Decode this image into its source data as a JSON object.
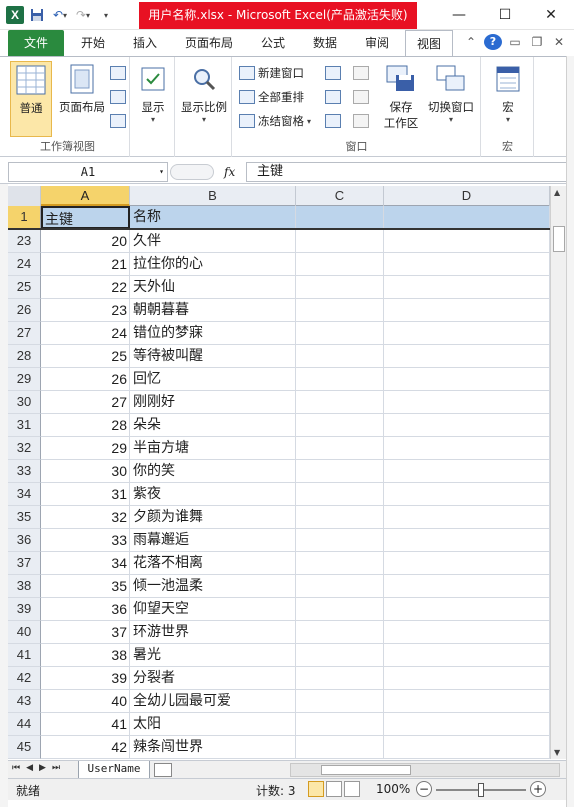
{
  "window": {
    "title": "用户名称.xlsx - Microsoft Excel(产品激活失败)",
    "app_icon": "excel-logo",
    "minimize": "—",
    "maximize": "☐",
    "close": "✕"
  },
  "ribbon_tabs": [
    "文件",
    "开始",
    "插入",
    "页面布局",
    "公式",
    "数据",
    "审阅",
    "视图"
  ],
  "active_tab": "视图",
  "ribbon": {
    "workbook_views": {
      "normal": "普通",
      "page_layout": "页面布局",
      "group_label": "工作簿视图"
    },
    "show": {
      "label": "显示"
    },
    "zoom": {
      "label": "显示比例"
    },
    "window": {
      "new_window": "新建窗口",
      "arrange_all": "全部重排",
      "freeze_panes": "冻结窗格",
      "save_workspace_line1": "保存",
      "save_workspace_line2": "工作区",
      "switch_windows": "切换窗口",
      "group_label": "窗口"
    },
    "macros": {
      "label": "宏",
      "group_label": "宏"
    }
  },
  "formula_bar": {
    "name_box": "A1",
    "fx": "fx",
    "content": "主键"
  },
  "grid": {
    "columns": [
      "A",
      "B",
      "C",
      "D"
    ],
    "header_row": {
      "num": "1",
      "a": "主键",
      "b": "名称"
    },
    "rows": [
      {
        "num": "23",
        "a": "20",
        "b": "久伴"
      },
      {
        "num": "24",
        "a": "21",
        "b": "拉住你的心"
      },
      {
        "num": "25",
        "a": "22",
        "b": "天外仙"
      },
      {
        "num": "26",
        "a": "23",
        "b": "朝朝暮暮"
      },
      {
        "num": "27",
        "a": "24",
        "b": "错位的梦寐"
      },
      {
        "num": "28",
        "a": "25",
        "b": "等待被叫醒"
      },
      {
        "num": "29",
        "a": "26",
        "b": "回忆"
      },
      {
        "num": "30",
        "a": "27",
        "b": "刚刚好"
      },
      {
        "num": "31",
        "a": "28",
        "b": "朵朵"
      },
      {
        "num": "32",
        "a": "29",
        "b": "半亩方塘"
      },
      {
        "num": "33",
        "a": "30",
        "b": "你的笑"
      },
      {
        "num": "34",
        "a": "31",
        "b": "紫夜"
      },
      {
        "num": "35",
        "a": "32",
        "b": "夕颜为谁舞"
      },
      {
        "num": "36",
        "a": "33",
        "b": "雨幕邂逅"
      },
      {
        "num": "37",
        "a": "34",
        "b": "花落不相离"
      },
      {
        "num": "38",
        "a": "35",
        "b": "倾一池温柔"
      },
      {
        "num": "39",
        "a": "36",
        "b": "仰望天空"
      },
      {
        "num": "40",
        "a": "37",
        "b": "环游世界"
      },
      {
        "num": "41",
        "a": "38",
        "b": "暑光"
      },
      {
        "num": "42",
        "a": "39",
        "b": "分裂者"
      },
      {
        "num": "43",
        "a": "40",
        "b": "全幼儿园最可爱"
      },
      {
        "num": "44",
        "a": "41",
        "b": "太阳"
      },
      {
        "num": "45",
        "a": "42",
        "b": "辣条闯世界"
      }
    ]
  },
  "sheet_tabs": [
    "UserName"
  ],
  "status": {
    "ready": "就绪",
    "count": "计数: 3",
    "zoom": "100%",
    "zoom_minus": "−",
    "zoom_plus": "+",
    "zoom_fraction": 0.5
  }
}
